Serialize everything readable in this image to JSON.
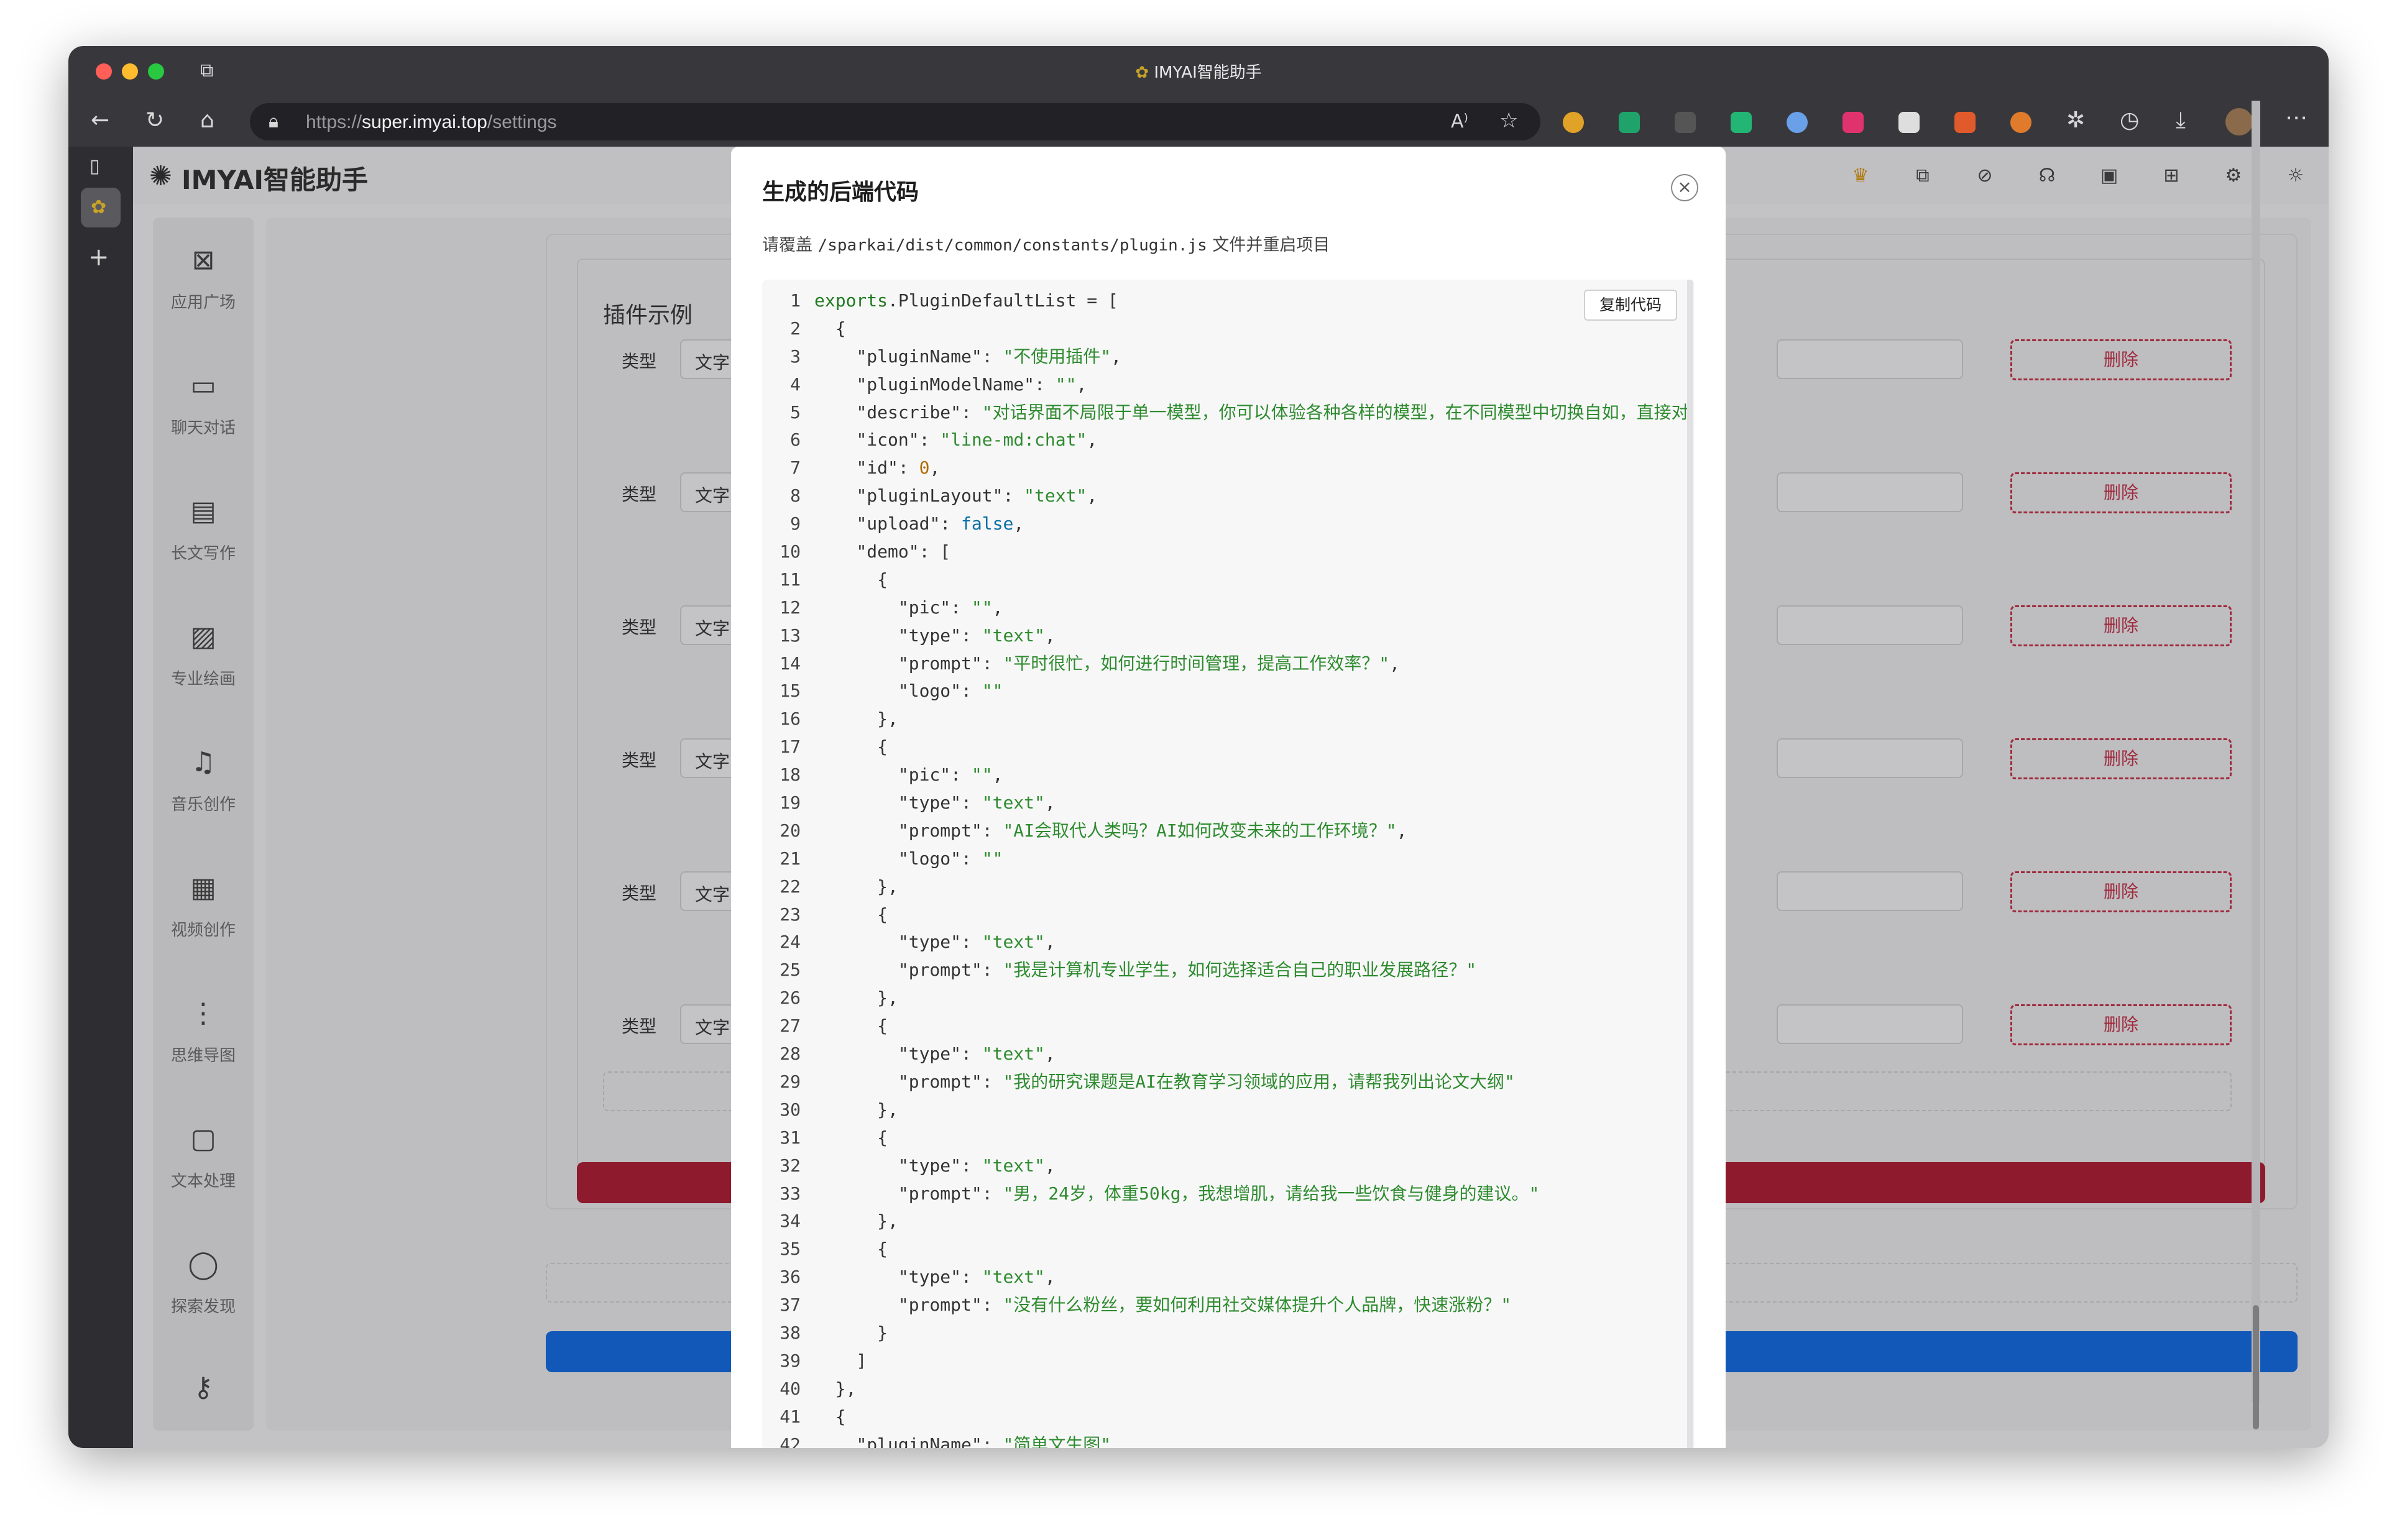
{
  "browser": {
    "title": "IMYAI智能助手",
    "url_scheme": "https://",
    "url_host": "super.imyai.top",
    "url_path": "/settings"
  },
  "app": {
    "brand": "IMYAI智能助手",
    "sidebar": [
      {
        "label": "应用广场",
        "icon": "app-grid-icon"
      },
      {
        "label": "聊天对话",
        "icon": "chat-icon"
      },
      {
        "label": "长文写作",
        "icon": "document-icon"
      },
      {
        "label": "专业绘画",
        "icon": "image-icon"
      },
      {
        "label": "音乐创作",
        "icon": "music-icon"
      },
      {
        "label": "视频创作",
        "icon": "video-icon"
      },
      {
        "label": "思维导图",
        "icon": "mindmap-icon"
      },
      {
        "label": "文本处理",
        "icon": "text-icon"
      },
      {
        "label": "探索发现",
        "icon": "planet-icon"
      }
    ],
    "section_title": "插件示例",
    "rows": [
      {
        "label": "类型",
        "value": "文字",
        "delete": "删除"
      },
      {
        "label": "类型",
        "value": "文字",
        "delete": "删除"
      },
      {
        "label": "类型",
        "value": "文字",
        "delete": "删除"
      },
      {
        "label": "类型",
        "value": "文字",
        "delete": "删除"
      },
      {
        "label": "类型",
        "value": "文字",
        "delete": "删除"
      },
      {
        "label": "类型",
        "value": "文字",
        "delete": "删除"
      }
    ]
  },
  "modal": {
    "title": "生成的后端代码",
    "desc_prefix": "请覆盖",
    "desc_path": "/sparkai/dist/common/constants/plugin.js",
    "desc_suffix": "文件并重启项目",
    "copy_label": "复制代码",
    "close_icon": "close-icon",
    "code_lines": [
      "exports.PluginDefaultList = [",
      "  {",
      "    \"pluginName\": \"不使用插件\",",
      "    \"pluginModelName\": \"\",",
      "    \"describe\": \"对话界面不局限于单一模型，你可以体验各种各样的模型，在不同模型中切换自如，直接对",
      "    \"icon\": \"line-md:chat\",",
      "    \"id\": 0,",
      "    \"pluginLayout\": \"text\",",
      "    \"upload\": false,",
      "    \"demo\": [",
      "      {",
      "        \"pic\": \"\",",
      "        \"type\": \"text\",",
      "        \"prompt\": \"平时很忙，如何进行时间管理，提高工作效率？\",",
      "        \"logo\": \"\"",
      "      },",
      "      {",
      "        \"pic\": \"\",",
      "        \"type\": \"text\",",
      "        \"prompt\": \"AI会取代人类吗？AI如何改变未来的工作环境？\",",
      "        \"logo\": \"\"",
      "      },",
      "      {",
      "        \"type\": \"text\",",
      "        \"prompt\": \"我是计算机专业学生，如何选择适合自己的职业发展路径？\"",
      "      },",
      "      {",
      "        \"type\": \"text\",",
      "        \"prompt\": \"我的研究课题是AI在教育学习领域的应用，请帮我列出论文大纲\"",
      "      },",
      "      {",
      "        \"type\": \"text\",",
      "        \"prompt\": \"男，24岁，体重50kg，我想增肌，请给我一些饮食与健身的建议。\"",
      "      },",
      "      {",
      "        \"type\": \"text\",",
      "        \"prompt\": \"没有什么粉丝，要如何利用社交媒体提升个人品牌，快速涨粉？\"",
      "      }",
      "    ]",
      "  },",
      "  {",
      "    \"pluginName\": \"简单文生图\","
    ]
  },
  "colors": {
    "accent_red": "#8e1a2d",
    "accent_blue": "#1258b8",
    "code_green": "#2e8b2e"
  }
}
